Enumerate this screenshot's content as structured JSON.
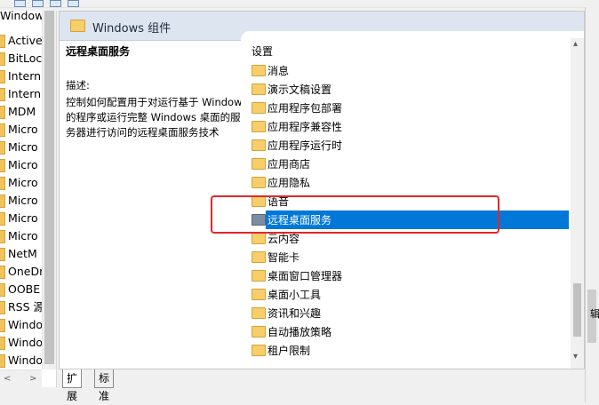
{
  "tree": {
    "items": [
      "Windows",
      "Active",
      "BitLoc",
      "Intern",
      "Intern",
      "MDM",
      "Micro",
      "Micro",
      "Micro",
      "Micro",
      "Micro",
      "Micro",
      "Micro",
      "NetM",
      "OneDr",
      "OOBE",
      "RSS 源",
      "Windo",
      "Windo",
      "Windo"
    ]
  },
  "header": {
    "title": "Windows 组件"
  },
  "description": {
    "title": "远程桌面服务",
    "label": "描述:",
    "text": "控制如何配置用于对运行基于 Windows 的程序或运行完整 Windows 桌面的服务器进行访问的远程桌面服务技术"
  },
  "list": {
    "column_header": "设置",
    "items": [
      "消息",
      "演示文稿设置",
      "应用程序包部署",
      "应用程序兼容性",
      "应用程序运行时",
      "应用商店",
      "应用隐私",
      "语音",
      "远程桌面服务",
      "云内容",
      "智能卡",
      "桌面窗口管理器",
      "桌面小工具",
      "资讯和兴趣",
      "自动播放策略",
      "租户限制"
    ],
    "selected": "远程桌面服务"
  },
  "tabs": {
    "extended": "扩展",
    "standard": "标准"
  },
  "right_strip": {
    "glyph": "辑"
  },
  "colors": {
    "selection": "#0078d7",
    "highlight_box": "#e3262b",
    "header_bg": "#dde5f0"
  }
}
